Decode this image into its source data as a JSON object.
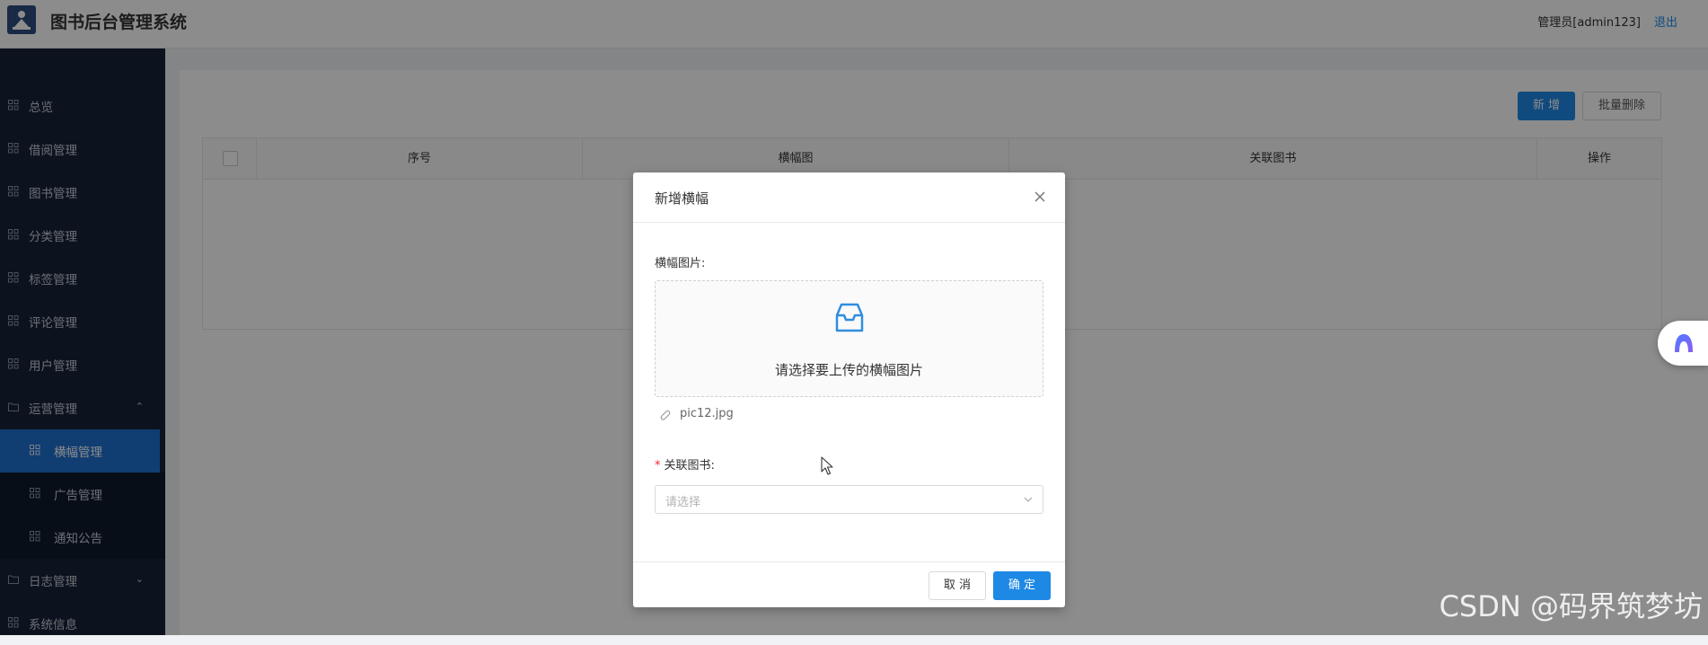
{
  "header": {
    "app_title": "图书后台管理系统",
    "user_label": "管理员[admin123]",
    "logout_label": "退出"
  },
  "sidebar": {
    "items": [
      {
        "label": "总览"
      },
      {
        "label": "借阅管理"
      },
      {
        "label": "图书管理"
      },
      {
        "label": "分类管理"
      },
      {
        "label": "标签管理"
      },
      {
        "label": "评论管理"
      },
      {
        "label": "用户管理"
      },
      {
        "label": "运营管理",
        "expanded": true
      },
      {
        "label": "横幅管理",
        "active": true
      },
      {
        "label": "广告管理"
      },
      {
        "label": "通知公告"
      },
      {
        "label": "日志管理",
        "expanded": false
      },
      {
        "label": "系统信息"
      }
    ]
  },
  "toolbar": {
    "add_label": "新 增",
    "batch_delete_label": "批量删除"
  },
  "table": {
    "columns": [
      "序号",
      "横幅图",
      "关联图书",
      "操作"
    ]
  },
  "modal": {
    "title": "新增横幅",
    "image_field_label": "横幅图片:",
    "upload_hint": "请选择要上传的横幅图片",
    "uploaded_file": "pic12.jpg",
    "book_field_label": "关联图书:",
    "book_placeholder": "请选择",
    "cancel_label": "取 消",
    "ok_label": "确 定"
  },
  "watermark": "CSDN @码界筑梦坊",
  "colors": {
    "primary": "#1e88e5",
    "sidebar_bg": "#17243a",
    "sidebar_active": "#1e6fd0",
    "required": "#f5222d"
  }
}
